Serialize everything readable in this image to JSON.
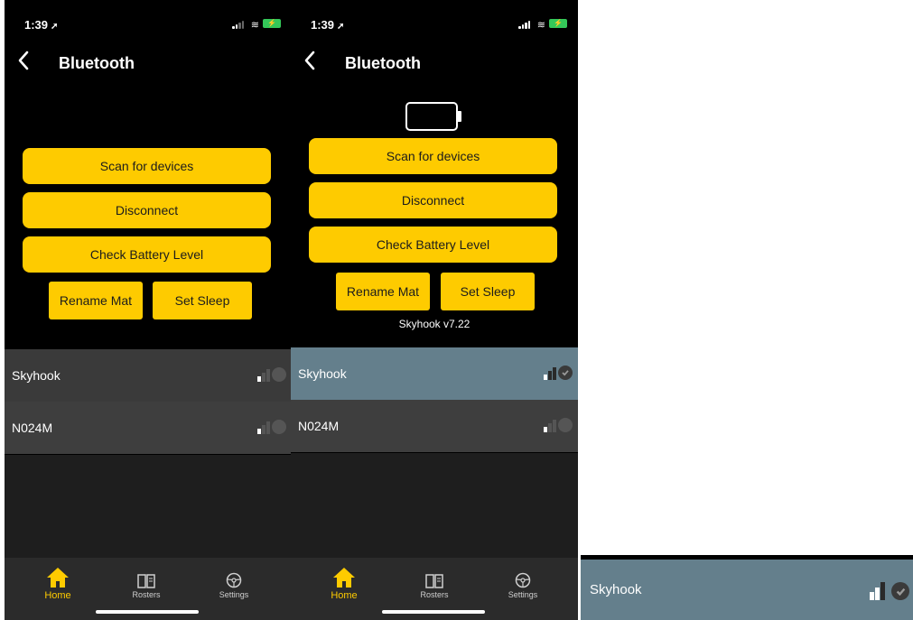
{
  "status": {
    "time": "1:39",
    "location_glyph": "➚",
    "wifi_glyph": "≋",
    "battery_glyph": "⚡"
  },
  "nav": {
    "title": "Bluetooth",
    "back_label": "<"
  },
  "buttons": {
    "scan": "Scan for devices",
    "disconnect": "Disconnect",
    "check_battery": "Check Battery Level",
    "rename": "Rename Mat",
    "sleep": "Set Sleep"
  },
  "firmware": "Skyhook v7.22",
  "devices": [
    {
      "name": "Skyhook"
    },
    {
      "name": "N024M"
    }
  ],
  "tabs": {
    "home": "Home",
    "rosters": "Rosters",
    "settings": "Settings"
  },
  "colors": {
    "accent": "#fecb00",
    "selected_row": "#647f8c",
    "row": "#3e3e3e",
    "tabbar": "#2b2b2b"
  },
  "icons": [
    "back-chevron-icon",
    "battery-empty-icon",
    "signal-icon",
    "check-icon",
    "home-icon",
    "book-icon",
    "steering-wheel-icon"
  ]
}
